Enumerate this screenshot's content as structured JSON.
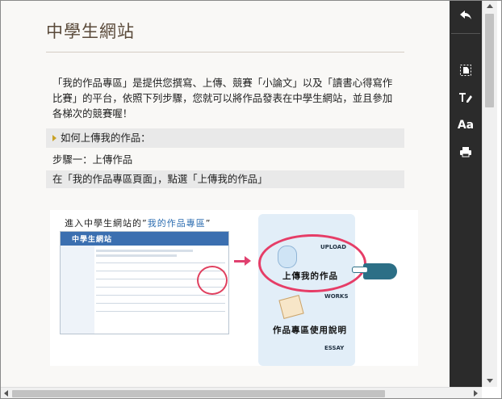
{
  "article": {
    "title": "中學生網站",
    "intro": "「我的作品專區」是提供您撰寫、上傳、競賽「小論文」以及「讀書心得寫作比賽」的平台，依照下列步驟，您就可以將作品發表在中學生網站，並且參加各梯次的競賽喔！",
    "section_heading": "如何上傳我的作品：",
    "step1": "步驟一：上傳作品",
    "step1_detail": "在「我的作品專區頁面」，點選「上傳我的作品」"
  },
  "illustration": {
    "caption_prefix": "進入中學生網站的”",
    "caption_highlight": "我的作品專區",
    "caption_suffix": "”",
    "mini_site_logo": "中學生網站",
    "upload_label": "UPLOAD",
    "upload_text": "上傳我的作品",
    "works_label": "WORKS",
    "works_text": "作品專區使用說明",
    "essay_label": "ESSAY"
  },
  "toolbar": {
    "icons": [
      "back-arrow-icon",
      "evernote-icon",
      "text-edit-icon",
      "font-size-icon",
      "print-icon"
    ],
    "font_label": "Aa"
  },
  "colors": {
    "toolbar_bg": "#2b2b2b",
    "accent_red": "#e63d67",
    "link_blue": "#2b6cb0",
    "section_bg": "#e9e9e9"
  }
}
